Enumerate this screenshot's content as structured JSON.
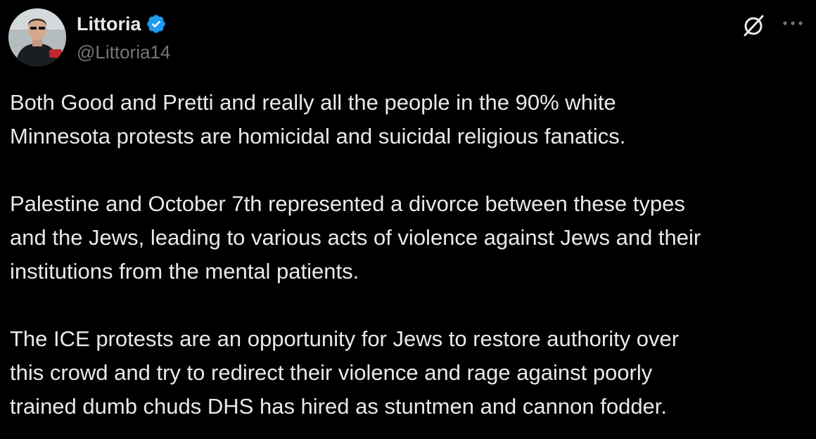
{
  "author": {
    "display_name": "Littoria",
    "handle": "@Littoria14",
    "verified": true
  },
  "icons": {
    "avatar": "user-avatar",
    "verified": "verified-badge-icon",
    "grok": "grok-icon",
    "more": "more-options-icon"
  },
  "colors": {
    "background": "#000000",
    "text": "#e7e9ea",
    "muted": "#71767b",
    "verified": "#1d9bf0"
  },
  "tweet": {
    "paragraphs": [
      "Both Good and Pretti and really all the people in the 90% white\nMinnesota protests are homicidal and suicidal religious fanatics.",
      "Palestine and October 7th represented a divorce between these types\nand the Jews, leading to various acts of violence against Jews and their\ninstitutions from the mental patients.",
      "The ICE protests are an opportunity for Jews to restore authority over\nthis crowd and try to redirect their violence and rage against poorly\ntrained dumb chuds DHS has hired as stuntmen and cannon fodder."
    ]
  }
}
